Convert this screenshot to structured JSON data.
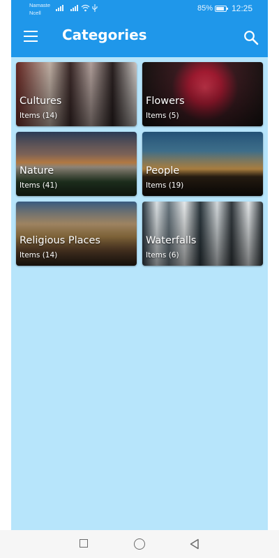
{
  "status_bar": {
    "carrier_line1": "Namaste",
    "carrier_line2": "Ncell",
    "battery_percent": "85%",
    "battery_level": 0.85,
    "time": "12:25"
  },
  "app_bar": {
    "title": "Categories",
    "menu_icon": "hamburger-menu-icon",
    "search_icon": "search-icon",
    "color": "#1f97ea"
  },
  "background_color": "#b7e5fb",
  "categories": [
    {
      "name": "Cultures",
      "count": "Items (14)"
    },
    {
      "name": "Flowers",
      "count": "Items (5)"
    },
    {
      "name": "Nature",
      "count": "Items (41)"
    },
    {
      "name": "People",
      "count": "Items (19)"
    },
    {
      "name": "Religious Places",
      "count": "Items (14)"
    },
    {
      "name": "Waterfalls",
      "count": "Items (6)"
    }
  ],
  "nav_bar": {
    "recents_icon": "square-recents-icon",
    "home_icon": "circle-home-icon",
    "back_icon": "triangle-back-icon"
  }
}
